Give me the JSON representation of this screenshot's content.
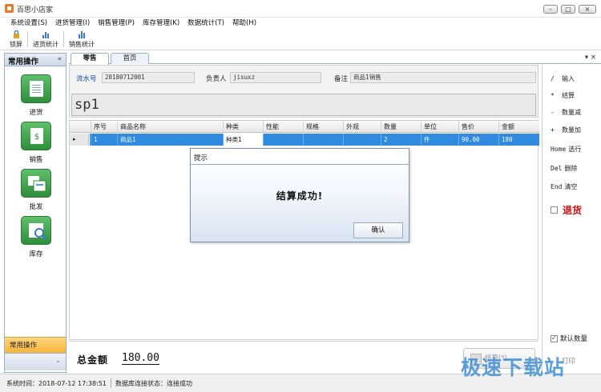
{
  "window": {
    "title": "百思小店家",
    "controls": {
      "minimize": "–",
      "maximize": "□",
      "close": "×"
    }
  },
  "menu": [
    "系统设置(S)",
    "进货管理(I)",
    "销售管理(P)",
    "库存管理(K)",
    "数据统计(T)",
    "帮助(H)"
  ],
  "toolbar": [
    {
      "label": "锁屏",
      "icon": "lock-icon"
    },
    {
      "label": "进货统计",
      "icon": "bar-chart-icon"
    },
    {
      "label": "销售统计",
      "icon": "bar-chart-icon"
    }
  ],
  "sidebar": {
    "title": "常用操作",
    "collapse": "«",
    "items": [
      {
        "label": "进货",
        "icon": "purchase-icon"
      },
      {
        "label": "销售",
        "icon": "sales-icon"
      },
      {
        "label": "批发",
        "icon": "wholesale-icon"
      },
      {
        "label": "库存",
        "icon": "inventory-icon"
      }
    ],
    "footer": "常用操作",
    "footer_chevron": "⌄"
  },
  "tabs": [
    {
      "label": "零售",
      "active": true
    },
    {
      "label": "首页",
      "active": false
    }
  ],
  "tab_tools": "▾ ×",
  "form": {
    "serial_label": "流水号",
    "serial_value": "20180712001",
    "manager_label": "负责人",
    "manager_value": "jisuxz",
    "note_label": "备注",
    "note_value": "商品1销售",
    "scan_value": "sp1"
  },
  "table": {
    "columns": [
      "序号",
      "商品名称",
      "种类",
      "性能",
      "规格",
      "外观",
      "数量",
      "单位",
      "售价",
      "金额"
    ],
    "row_indicator": "▸",
    "rows": [
      {
        "no": "1",
        "name": "商品1",
        "category": "种类1",
        "performance": "",
        "spec": "",
        "appearance": "",
        "qty": "2",
        "unit": "件",
        "price": "90.00",
        "amount": "180"
      }
    ]
  },
  "dialog": {
    "title": "提示",
    "message": "结算成功!",
    "ok": "确认"
  },
  "shortcuts": [
    {
      "key": "/",
      "label": "输入"
    },
    {
      "key": "*",
      "label": "结算"
    },
    {
      "key": "-",
      "label": "数量减"
    },
    {
      "key": "+",
      "label": "数量加"
    },
    {
      "key": "Home",
      "label": "选行"
    },
    {
      "key": "Del",
      "label": "删除"
    },
    {
      "key": "End",
      "label": "清空"
    }
  ],
  "refund": {
    "label": "退货",
    "checked": false
  },
  "default_qty": {
    "label": "默认数量",
    "checked": true
  },
  "print_label": "打印",
  "total": {
    "label": "总金额",
    "value": "180.00"
  },
  "settle_button": "结算(*)",
  "status": {
    "time": "系统时间：2018-07-12 17:38:51",
    "db": "数据库连接状态：连接成功"
  },
  "watermark": "极速下载站",
  "colors": {
    "selection": "#2f8ae0",
    "accent": "#1a4fa0",
    "refund": "#d01010",
    "sidebar_icon": "#3ca64a"
  }
}
